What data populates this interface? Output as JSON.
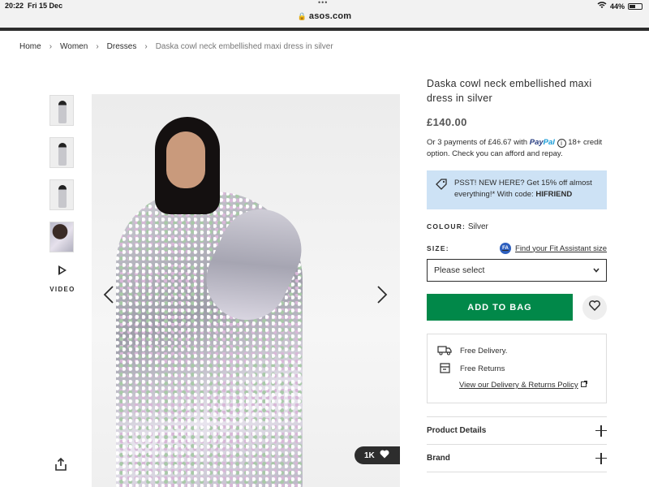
{
  "status_bar": {
    "time": "20:22",
    "date": "Fri 15 Dec",
    "battery": "44%"
  },
  "browser": {
    "url": "asos.com"
  },
  "breadcrumb": [
    {
      "label": "Home"
    },
    {
      "label": "Women"
    },
    {
      "label": "Dresses"
    },
    {
      "label": "Daska cowl neck embellished maxi dress in silver"
    }
  ],
  "gallery": {
    "video_label": "VIDEO",
    "likes": "1K"
  },
  "product": {
    "title": "Daska cowl neck embellished maxi dress in silver",
    "price": "£140.00",
    "payment_pre": "Or 3 payments of £46.67 with",
    "paypal_pay": "Pay",
    "paypal_pal": "Pal",
    "payment_post": "18+ credit option. Check you can afford and repay.",
    "promo_text": "PSST! NEW HERE? Get 15% off almost everything!* With code:",
    "promo_code": "HIFRIEND",
    "colour_label": "COLOUR:",
    "colour_value": "Silver",
    "size_label": "SIZE:",
    "fit_assistant": "Find your Fit Assistant size",
    "size_select": "Please select",
    "add_to_bag": "ADD TO BAG",
    "free_delivery": "Free Delivery.",
    "free_returns": "Free Returns",
    "policy_link": "View our Delivery & Returns Policy",
    "accordions": [
      "Product Details",
      "Brand"
    ]
  },
  "colors": {
    "accent_green": "#018849",
    "promo_bg": "#cde2f5",
    "text": "#2d2d2d"
  }
}
